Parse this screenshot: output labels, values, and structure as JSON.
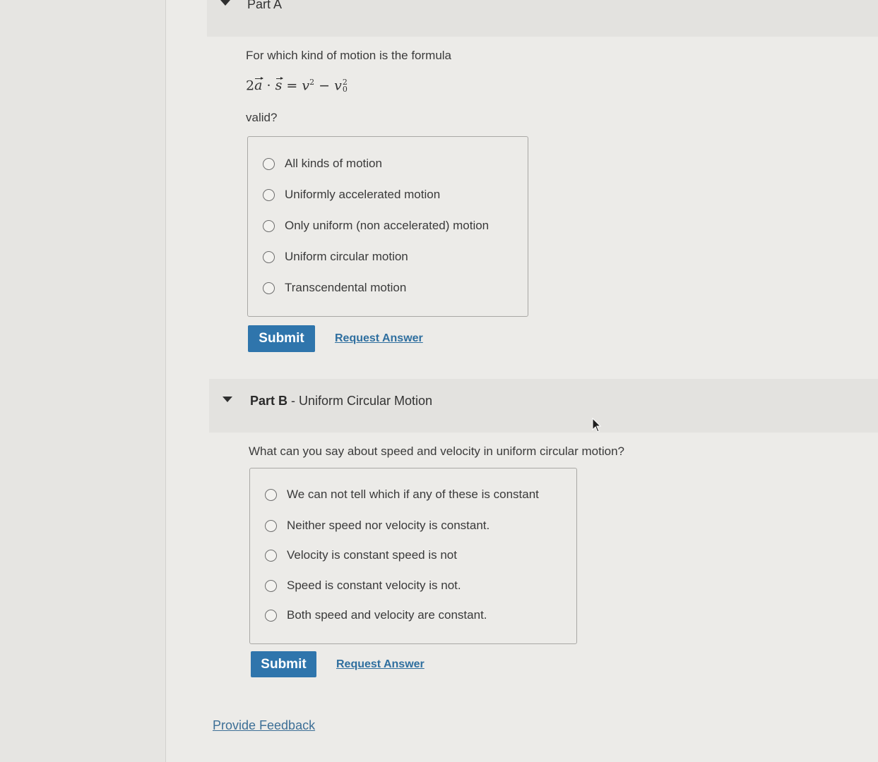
{
  "partA": {
    "label": "Part A",
    "question_intro": "For which kind of motion is the formula",
    "question_end": "valid?",
    "options": [
      "All kinds of motion",
      "Uniformly accelerated motion",
      "Only uniform (non accelerated) motion",
      "Uniform circular motion",
      "Transcendental motion"
    ],
    "submit_label": "Submit",
    "request_answer_label": "Request Answer"
  },
  "formula": {
    "coef": "2",
    "a": "a",
    "dot": "·",
    "s": "s",
    "eq": "=",
    "v": "v",
    "exp": "2",
    "minus": "−",
    "v0": "v",
    "sub0": "0"
  },
  "partB": {
    "label_bold": "Part B",
    "label_rest": " - Uniform Circular Motion",
    "question": "What can you say about speed and velocity in uniform circular motion?",
    "options": [
      "We can not tell which if any of these is constant",
      "Neither speed nor velocity is constant.",
      "Velocity is constant speed is not",
      "Speed is constant velocity is not.",
      "Both speed and velocity  are constant."
    ],
    "submit_label": "Submit",
    "request_answer_label": "Request Answer"
  },
  "feedback_label": "Provide Feedback",
  "colors": {
    "submit_bg": "#2f75ac",
    "link": "#2f6f9f"
  }
}
